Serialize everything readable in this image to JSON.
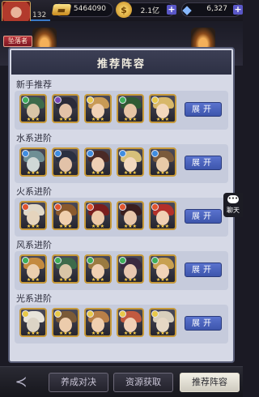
{
  "status": {
    "level": "132",
    "title_badge": "坠落者",
    "currency1": {
      "icon": "gold-bar-icon",
      "value": "5464090"
    },
    "currency2": {
      "icon": "coin-icon",
      "value": "2.1亿"
    },
    "currency3": {
      "icon": "gem-icon",
      "value": "6,327"
    }
  },
  "panel": {
    "title": "推荐阵容",
    "expand_label": "展开",
    "sections": [
      {
        "title": "新手推荐",
        "heroes": [
          {
            "element": "wind",
            "hair": "#3d6a4a",
            "face": "#d8c5a6"
          },
          {
            "element": "dark",
            "hair": "#2b2b38",
            "face": "#e3c2a7"
          },
          {
            "element": "light",
            "hair": "#c89a55",
            "face": "#f0d2b6"
          },
          {
            "element": "wind",
            "hair": "#2f5a34",
            "face": "#e6c4a5"
          },
          {
            "element": "light",
            "hair": "#d8b86a",
            "face": "#f3d8bd"
          }
        ]
      },
      {
        "title": "水系进阶",
        "heroes": [
          {
            "element": "water",
            "hair": "#6f8f95",
            "face": "#d0d8d6"
          },
          {
            "element": "water",
            "hair": "#2a3040",
            "face": "#e2c2a8"
          },
          {
            "element": "water",
            "hair": "#4a2a26",
            "face": "#efcfb5"
          },
          {
            "element": "water",
            "hair": "#d6c07a",
            "face": "#f2d9bf"
          },
          {
            "element": "water",
            "hair": "#7a5a3c",
            "face": "#e8caa8"
          }
        ]
      },
      {
        "title": "火系进阶",
        "heroes": [
          {
            "element": "fire",
            "hair": "#e0d8c8",
            "face": "#e5d4bd"
          },
          {
            "element": "fire",
            "hair": "#8a5a2e",
            "face": "#f0cfae"
          },
          {
            "element": "fire",
            "hair": "#7a1e1e",
            "face": "#edc8a8"
          },
          {
            "element": "fire",
            "hair": "#3a1e1e",
            "face": "#e8c6aa"
          },
          {
            "element": "fire",
            "hair": "#b3302a",
            "face": "#f0d0b4"
          }
        ]
      },
      {
        "title": "风系进阶",
        "heroes": [
          {
            "element": "wind",
            "hair": "#c38a40",
            "face": "#ebcfae"
          },
          {
            "element": "wind",
            "hair": "#3d6a4a",
            "face": "#d8c5a6"
          },
          {
            "element": "wind",
            "hair": "#9a7a40",
            "face": "#f0d0b2"
          },
          {
            "element": "wind",
            "hair": "#3a2a40",
            "face": "#e8c8b0"
          },
          {
            "element": "wind",
            "hair": "#c8a050",
            "face": "#f1d3b8"
          }
        ]
      },
      {
        "title": "光系进阶",
        "heroes": [
          {
            "element": "light",
            "hair": "#e8e4da",
            "face": "#dcd4c6"
          },
          {
            "element": "light",
            "hair": "#7a5a38",
            "face": "#ecccac"
          },
          {
            "element": "light",
            "hair": "#b88048",
            "face": "#efcfb0"
          },
          {
            "element": "light",
            "hair": "#c25a40",
            "face": "#f0d0b6"
          },
          {
            "element": "light",
            "hair": "#d8cfbc",
            "face": "#e6d8c4"
          }
        ]
      }
    ]
  },
  "side": {
    "chat_label": "聊天"
  },
  "bottom": {
    "tabs": [
      "养成对决",
      "资源获取",
      "推荐阵容"
    ],
    "active_tab": "推荐阵容"
  },
  "colors": {
    "accent": "#4a63c0",
    "panel_bg": "#d6d9e6",
    "frame_gold": "#c79a3a"
  },
  "element_colors": {
    "wind": "#3fae5a",
    "water": "#3f8de0",
    "fire": "#e0542f",
    "light": "#e8c94a",
    "dark": "#7a4ab8"
  }
}
